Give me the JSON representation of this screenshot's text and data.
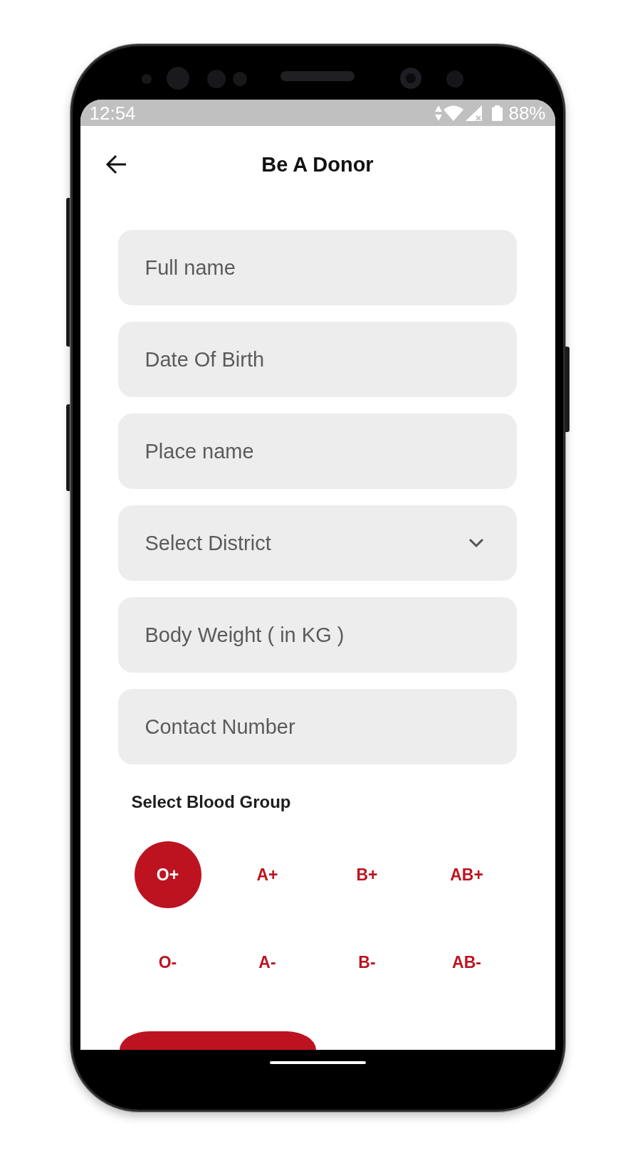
{
  "status_bar": {
    "time": "12:54",
    "battery": "88%"
  },
  "header": {
    "title": "Be A Donor"
  },
  "form": {
    "fields": [
      {
        "kind": "text",
        "placeholder": "Full name"
      },
      {
        "kind": "text",
        "placeholder": "Date Of Birth"
      },
      {
        "kind": "text",
        "placeholder": "Place name"
      },
      {
        "kind": "dropdown",
        "placeholder": "Select District"
      },
      {
        "kind": "text",
        "placeholder": "Body Weight ( in KG )"
      },
      {
        "kind": "text",
        "placeholder": "Contact Number"
      }
    ]
  },
  "blood_group": {
    "label": "Select Blood Group",
    "options": [
      {
        "label": "O+",
        "selected": true
      },
      {
        "label": "A+",
        "selected": false
      },
      {
        "label": "B+",
        "selected": false
      },
      {
        "label": "AB+",
        "selected": false
      },
      {
        "label": "O-",
        "selected": false
      },
      {
        "label": "A-",
        "selected": false
      },
      {
        "label": "B-",
        "selected": false
      },
      {
        "label": "AB-",
        "selected": false
      }
    ]
  }
}
